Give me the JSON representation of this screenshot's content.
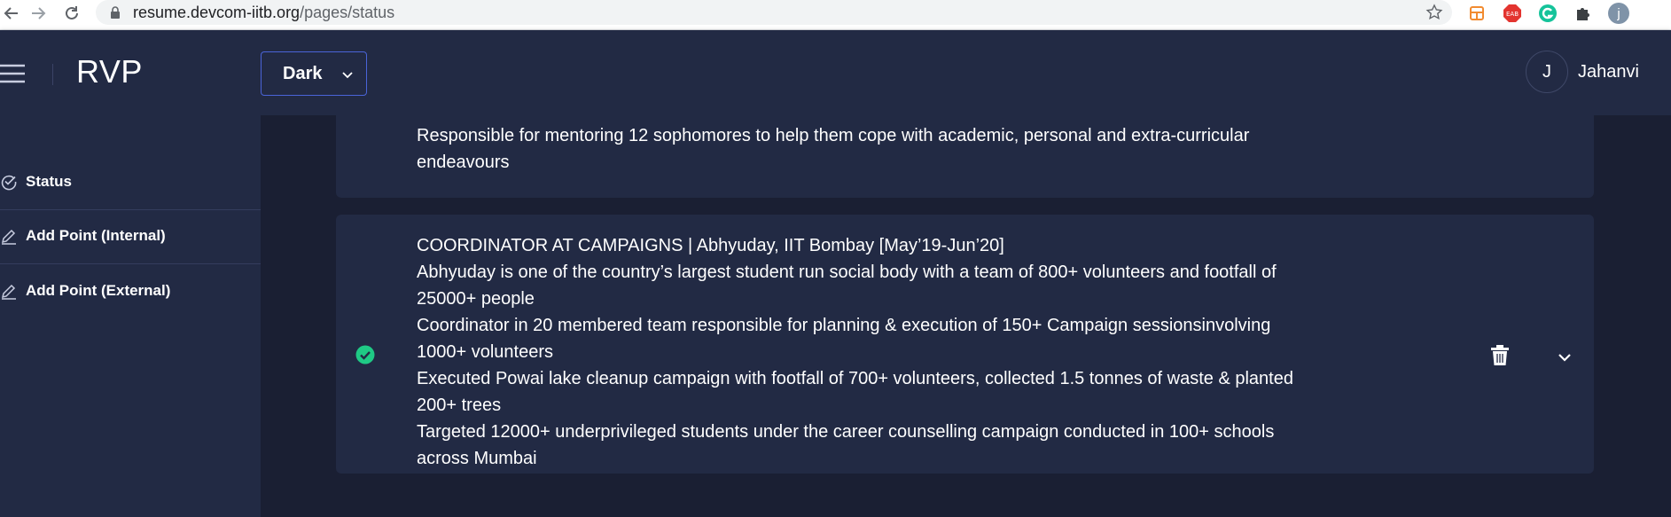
{
  "browser": {
    "url_host": "resume.devcom-iitb.org",
    "url_path": "/pages/status",
    "profile_initial": "j",
    "ext_abp_label": "EAB"
  },
  "header": {
    "title": "RVP",
    "theme_select_value": "Dark",
    "user_initial": "J",
    "user_name": "Jahanvi"
  },
  "sidebar": {
    "items": [
      {
        "label": "Status",
        "icon": "check-circle-icon"
      },
      {
        "label": "Add Point (Internal)",
        "icon": "edit-icon"
      },
      {
        "label": "Add Point (External)",
        "icon": "edit-icon"
      }
    ]
  },
  "cards": [
    {
      "lines": [
        " Responsible for mentoring 12 sophomores to help them cope with academic, personal and extra-curricular",
        "endeavours"
      ]
    },
    {
      "status": "approved",
      "lines": [
        "COORDINATOR AT CAMPAIGNS | Abhyuday, IIT Bombay [May’19-Jun’20]",
        "Abhyuday is one of the country’s largest student run social body with a team of 800+ volunteers and footfall of",
        "25000+ people",
        " Coordinator in 20 membered team responsible for planning & execution of 150+ Campaign sessionsinvolving",
        "1000+ volunteers",
        " Executed Powai lake cleanup campaign with footfall of 700+ volunteers, collected 1.5 tonnes of waste & planted",
        "200+ trees",
        " Targeted 12000+ underprivileged students under the career counselling campaign conducted in 100+ schools",
        "across Mumbai"
      ]
    }
  ],
  "colors": {
    "background": "#1a1f33",
    "surface": "#222a44",
    "accent_border": "#4a64d8",
    "approved_green": "#1fc985"
  }
}
